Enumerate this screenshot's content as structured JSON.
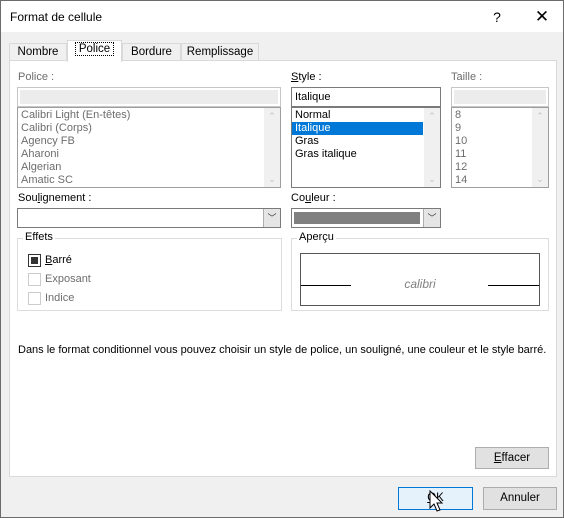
{
  "window": {
    "title": "Format de cellule",
    "help_icon": "?",
    "close_icon": "✕"
  },
  "tabs": [
    {
      "label": "Nombre",
      "active": false
    },
    {
      "label": "Police",
      "active": true
    },
    {
      "label": "Bordure",
      "active": false
    },
    {
      "label": "Remplissage",
      "active": false
    }
  ],
  "font": {
    "label": "Police :",
    "value": "",
    "options": [
      "Calibri Light (En-têtes)",
      "Calibri (Corps)",
      "Agency FB",
      "Aharoni",
      "Algerian",
      "Amatic SC"
    ],
    "disabled": true
  },
  "style": {
    "label_prefix": "",
    "label_accel": "S",
    "label_rest": "tyle :",
    "value": "Italique",
    "options": [
      "Normal",
      "Italique",
      "Gras",
      "Gras italique"
    ],
    "selected": "Italique"
  },
  "size": {
    "label": "Taille :",
    "value": "",
    "options": [
      "8",
      "9",
      "10",
      "11",
      "12",
      "14"
    ],
    "disabled": true
  },
  "underline": {
    "label_prefix": "Sou",
    "label_accel": "l",
    "label_rest": "ignement :",
    "value": ""
  },
  "color": {
    "label_prefix": "Co",
    "label_accel": "u",
    "label_rest": "leur :",
    "swatch_color": "#808080"
  },
  "effects": {
    "title": "Effets",
    "items": [
      {
        "accel": "B",
        "rest": "arré",
        "checked": true,
        "disabled": false
      },
      {
        "accel": "",
        "rest": "Exposant",
        "checked": false,
        "disabled": true
      },
      {
        "accel": "",
        "rest": "Indice",
        "checked": false,
        "disabled": true
      }
    ]
  },
  "preview": {
    "title": "Aperçu",
    "sample_text": "calibri"
  },
  "description": "Dans le format conditionnel vous pouvez choisir un style de police, un souligné, une couleur et le style barré.",
  "buttons": {
    "clear_accel": "E",
    "clear_rest": "ffacer",
    "ok_accel": "O",
    "ok_rest": "K",
    "cancel": "Annuler"
  },
  "colors": {
    "selection": "#0078d7",
    "default_button_border": "#0078d7"
  }
}
